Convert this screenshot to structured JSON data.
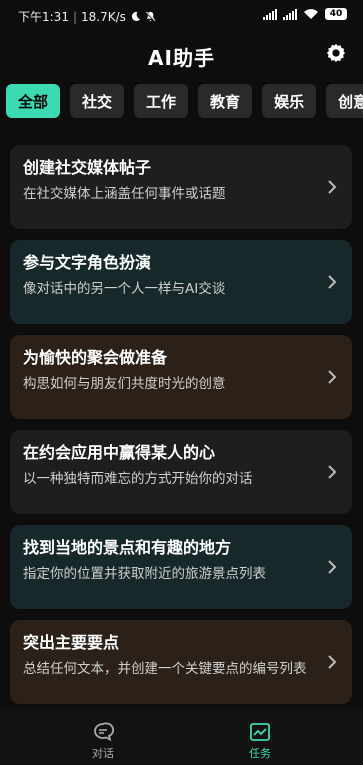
{
  "status": {
    "time": "下午1:31",
    "speed": "18.7K/s",
    "battery": "40"
  },
  "header": {
    "title": "AI助手"
  },
  "tabs": [
    {
      "label": "全部",
      "active": true
    },
    {
      "label": "社交",
      "active": false
    },
    {
      "label": "工作",
      "active": false
    },
    {
      "label": "教育",
      "active": false
    },
    {
      "label": "娱乐",
      "active": false
    },
    {
      "label": "创意",
      "active": false
    }
  ],
  "cards": [
    {
      "title": "创建社交媒体帖子",
      "desc": "在社交媒体上涵盖任何事件或话题",
      "color": "#1e1e1e"
    },
    {
      "title": "参与文字角色扮演",
      "desc": "像对话中的另一个人一样与AI交谈",
      "color": "#17282a"
    },
    {
      "title": "为愉快的聚会做准备",
      "desc": "构思如何与朋友们共度时光的创意",
      "color": "#2b2118"
    },
    {
      "title": "在约会应用中赢得某人的心",
      "desc": "以一种独特而难忘的方式开始你的对话",
      "color": "#1e1e1e"
    },
    {
      "title": "找到当地的景点和有趣的地方",
      "desc": "指定你的位置并获取附近的旅游景点列表",
      "color": "#17282a"
    },
    {
      "title": "突出主要要点",
      "desc": "总结任何文本，并创建一个关键要点的编号列表",
      "color": "#2b2118"
    }
  ],
  "nav": {
    "chat_label": "对话",
    "tasks_label": "任务",
    "accent": "#3dd9b1"
  }
}
